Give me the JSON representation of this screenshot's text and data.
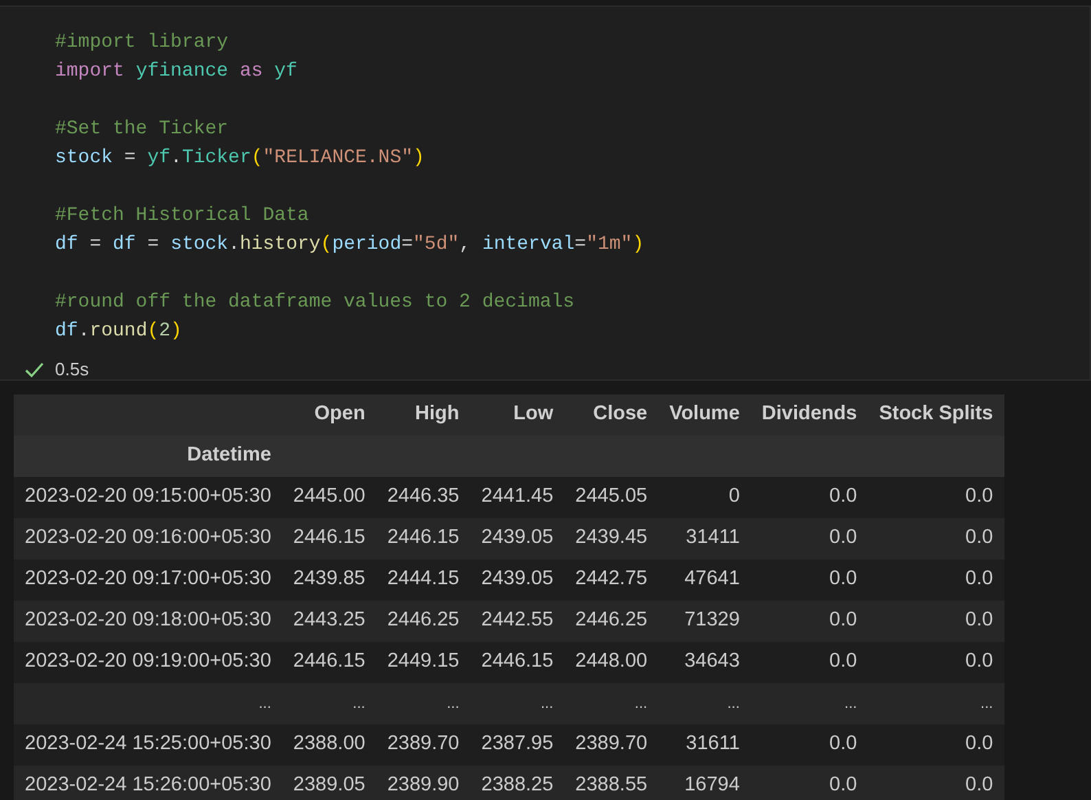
{
  "code_cell": {
    "blocks": [
      {
        "lines": [
          {
            "tokens": [
              {
                "kind": "comment",
                "text": "#import library"
              }
            ]
          },
          {
            "tokens": [
              {
                "kind": "keyword",
                "text": "import "
              },
              {
                "kind": "module",
                "text": "yfinance "
              },
              {
                "kind": "keyword",
                "text": "as "
              },
              {
                "kind": "module",
                "text": "yf"
              }
            ]
          }
        ]
      },
      {
        "lines": [
          {
            "tokens": [
              {
                "kind": "comment",
                "text": "#Set the Ticker"
              }
            ]
          },
          {
            "tokens": [
              {
                "kind": "variable",
                "text": "stock"
              },
              {
                "kind": "op",
                "text": " = "
              },
              {
                "kind": "module",
                "text": "yf"
              },
              {
                "kind": "op",
                "text": "."
              },
              {
                "kind": "module",
                "text": "Ticker"
              },
              {
                "kind": "paren",
                "text": "("
              },
              {
                "kind": "string",
                "text": "\"RELIANCE.NS\""
              },
              {
                "kind": "paren",
                "text": ")"
              }
            ]
          }
        ]
      },
      {
        "lines": [
          {
            "tokens": [
              {
                "kind": "comment",
                "text": "#Fetch Historical Data"
              }
            ]
          },
          {
            "tokens": [
              {
                "kind": "variable",
                "text": "df"
              },
              {
                "kind": "op",
                "text": " = "
              },
              {
                "kind": "variable",
                "text": "df"
              },
              {
                "kind": "op",
                "text": " = "
              },
              {
                "kind": "variable",
                "text": "stock"
              },
              {
                "kind": "op",
                "text": "."
              },
              {
                "kind": "function",
                "text": "history"
              },
              {
                "kind": "paren",
                "text": "("
              },
              {
                "kind": "variable",
                "text": "period"
              },
              {
                "kind": "op",
                "text": "="
              },
              {
                "kind": "string",
                "text": "\"5d\""
              },
              {
                "kind": "op",
                "text": ", "
              },
              {
                "kind": "variable",
                "text": "interval"
              },
              {
                "kind": "op",
                "text": "="
              },
              {
                "kind": "string",
                "text": "\"1m\""
              },
              {
                "kind": "paren",
                "text": ")"
              }
            ]
          }
        ]
      },
      {
        "lines": [
          {
            "tokens": [
              {
                "kind": "comment",
                "text": "#round off the dataframe values to 2 decimals"
              }
            ]
          },
          {
            "tokens": [
              {
                "kind": "variable",
                "text": "df"
              },
              {
                "kind": "op",
                "text": "."
              },
              {
                "kind": "function",
                "text": "round"
              },
              {
                "kind": "paren",
                "text": "("
              },
              {
                "kind": "number",
                "text": "2"
              },
              {
                "kind": "paren",
                "text": ")"
              }
            ]
          }
        ]
      }
    ],
    "success": true,
    "duration": "0.5s"
  },
  "table": {
    "columns": [
      null,
      "Open",
      "High",
      "Low",
      "Close",
      "Volume",
      "Dividends",
      "Stock Splits"
    ],
    "index_name": "Datetime",
    "rows": [
      [
        "2023-02-20 09:15:00+05:30",
        "2445.00",
        "2446.35",
        "2441.45",
        "2445.05",
        "0",
        "0.0",
        "0.0"
      ],
      [
        "2023-02-20 09:16:00+05:30",
        "2446.15",
        "2446.15",
        "2439.05",
        "2439.45",
        "31411",
        "0.0",
        "0.0"
      ],
      [
        "2023-02-20 09:17:00+05:30",
        "2439.85",
        "2444.15",
        "2439.05",
        "2442.75",
        "47641",
        "0.0",
        "0.0"
      ],
      [
        "2023-02-20 09:18:00+05:30",
        "2443.25",
        "2446.25",
        "2442.55",
        "2446.25",
        "71329",
        "0.0",
        "0.0"
      ],
      [
        "2023-02-20 09:19:00+05:30",
        "2446.15",
        "2449.15",
        "2446.15",
        "2448.00",
        "34643",
        "0.0",
        "0.0"
      ],
      [
        "...",
        "...",
        "...",
        "...",
        "...",
        "...",
        "...",
        "..."
      ],
      [
        "2023-02-24 15:25:00+05:30",
        "2388.00",
        "2389.70",
        "2387.95",
        "2389.70",
        "31611",
        "0.0",
        "0.0"
      ],
      [
        "2023-02-24 15:26:00+05:30",
        "2389.05",
        "2389.90",
        "2388.25",
        "2388.55",
        "16794",
        "0.0",
        "0.0"
      ]
    ]
  }
}
